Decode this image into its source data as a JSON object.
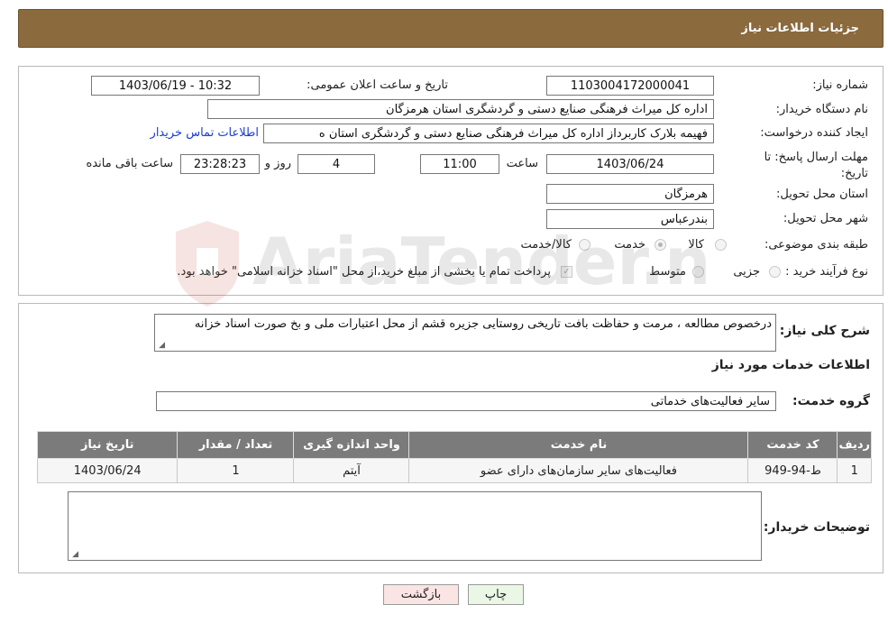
{
  "header": {
    "title": "جزئیات اطلاعات نیاز"
  },
  "form": {
    "need_number": {
      "label": "شماره نیاز:",
      "value": "1103004172000041"
    },
    "announce_datetime": {
      "label": "تاریخ و ساعت اعلان عمومی:",
      "value": "1403/06/19 - 10:32"
    },
    "buyer_org": {
      "label": "نام دستگاه خریدار:",
      "value": "اداره کل میراث فرهنگی  صنایع دستی و گردشگری استان هرمزگان"
    },
    "requester": {
      "label": "ایجاد کننده درخواست:",
      "value": "فهیمه بلارک کاربرداز اداره کل میراث فرهنگی  صنایع دستی و گردشگری استان ه",
      "contact_link": "اطلاعات تماس خریدار"
    },
    "deadline": {
      "label": "مهلت ارسال پاسخ: تا تاریخ:",
      "date": "1403/06/24",
      "time_label": "ساعت",
      "time": "11:00",
      "days": "4",
      "days_label": "روز و",
      "remaining": "23:28:23",
      "remaining_label": "ساعت باقی مانده"
    },
    "delivery_province": {
      "label": "استان محل تحویل:",
      "value": "هرمزگان"
    },
    "delivery_city": {
      "label": "شهر محل تحویل:",
      "value": "بندرعباس"
    },
    "category": {
      "label": "طبقه بندی موضوعی:",
      "options": [
        "کالا",
        "خدمت",
        "کالا/خدمت"
      ],
      "selected": "خدمت"
    },
    "purchase_type": {
      "label": "نوع فرآیند خرید :",
      "options": [
        "جزیی",
        "متوسط"
      ],
      "note": "پرداخت تمام یا بخشی از مبلغ خرید،از محل \"اسناد خزانه اسلامی\" خواهد بود."
    }
  },
  "details": {
    "description_label": "شرح کلی نیاز:",
    "description": "درخصوص مطالعه ، مرمت و حفاظت بافت تاریخی روستایی جزیره قشم از محل اعتبارات ملی و بخ صورت اسناد خزانه",
    "services_title": "اطلاعات خدمات مورد نیاز",
    "service_group_label": "گروه خدمت:",
    "service_group": "سایر فعالیت‌های خدماتی",
    "table": {
      "headers": [
        "ردیف",
        "کد خدمت",
        "نام خدمت",
        "واحد اندازه گیری",
        "تعداد / مقدار",
        "تاریخ نیاز"
      ],
      "rows": [
        [
          "1",
          "ط-94-949",
          "فعالیت‌های سایر سازمان‌های دارای عضو",
          "آیتم",
          "1",
          "1403/06/24"
        ]
      ]
    },
    "buyer_notes_label": "توضیحات خریدار:",
    "buyer_notes": ""
  },
  "buttons": {
    "print": "چاپ",
    "back": "بازگشت"
  },
  "watermark": {
    "text": "AriaTender.neT"
  }
}
